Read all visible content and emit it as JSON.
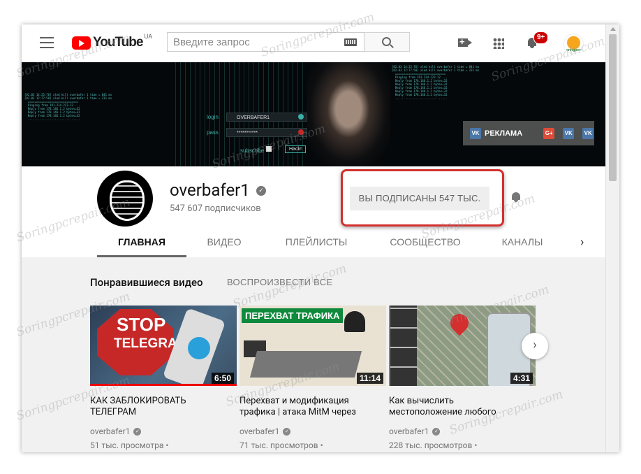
{
  "header": {
    "logo_text": "YouTube",
    "logo_region": "UA",
    "search_placeholder": "Введите запрос",
    "notifications_badge": "9+",
    "account_avatar_text": "soringpcrepair"
  },
  "banner": {
    "login_label": "login",
    "pass_label": "pass",
    "subscribe_label": "subscribe",
    "username_field": "OVERBAFER1",
    "password_field": "***********",
    "hack_button": "Hack!",
    "ads_vk1": "VK",
    "ads_label": "РЕКЛАМА",
    "ads_gplus": "G+",
    "ads_vk2": "VK",
    "ads_vk3": "VK"
  },
  "channel": {
    "name": "overbafer1",
    "subscribers": "547 607 подписчиков",
    "subscribe_button": "ВЫ ПОДПИСАНЫ  547 ТЫС."
  },
  "tabs": [
    {
      "label": "ГЛАВНАЯ"
    },
    {
      "label": "ВИДЕО"
    },
    {
      "label": "ПЛЕЙЛИСТЫ"
    },
    {
      "label": "СООБЩЕСТВО"
    },
    {
      "label": "КАНАЛЫ"
    }
  ],
  "section": {
    "title": "Понравившиеся видео",
    "play_all": "ВОСПРОИЗВЕСТИ ВСЕ"
  },
  "videos": [
    {
      "thumb_text1": "STOP",
      "thumb_text2": "TELEGRAM",
      "duration": "6:50",
      "progress_fraction": 1.0,
      "title": "КАК ЗАБЛОКИРОВАТЬ ТЕЛЕГРАМ",
      "channel": "overbafer1",
      "views": "51 тыс. просмотра •"
    },
    {
      "thumb_text1": "ПЕРЕХВАТ ТРАФИКА",
      "duration": "11:14",
      "title": "Перехват и модификация трафика | атака MitM через",
      "channel": "overbafer1",
      "views": "71 тыс. просмотров •"
    },
    {
      "duration": "4:31",
      "title": "Как вычислить местоположение любого",
      "channel": "overbafer1",
      "views": "228 тыс. просмотров •"
    }
  ],
  "watermark": "Soringpcrepair.com",
  "colors": {
    "brand_red": "#ff0000",
    "highlight_red": "#d32f2f",
    "badge_red": "#cc0000"
  }
}
